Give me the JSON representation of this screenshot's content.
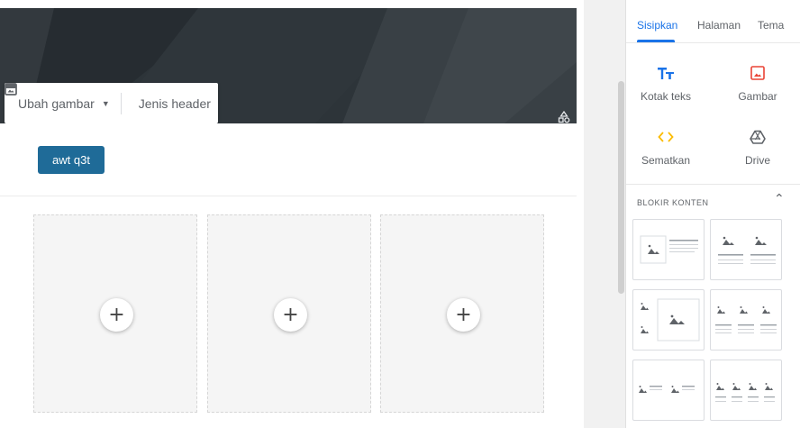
{
  "header": {
    "change_image_label": "Ubah gambar",
    "header_type_label": "Jenis header",
    "change_image_icon": "image-icon",
    "header_type_icon": "header-layout-icon",
    "theme_icon": "shapes-icon"
  },
  "main": {
    "button_label": "awt q3t",
    "button_color": "#1f6b98",
    "placeholders": [
      {
        "action": "+"
      },
      {
        "action": "+"
      },
      {
        "action": "+"
      }
    ]
  },
  "panel": {
    "tabs": [
      {
        "label": "Sisipkan",
        "active": true
      },
      {
        "label": "Halaman",
        "active": false
      },
      {
        "label": "Tema",
        "active": false
      }
    ],
    "insert_items": [
      {
        "label": "Kotak teks",
        "icon": "text-box-icon",
        "color": "#1a73e8"
      },
      {
        "label": "Gambar",
        "icon": "image-icon",
        "color": "#ea4335"
      },
      {
        "label": "Sematkan",
        "icon": "embed-icon",
        "color": "#fbbc04"
      },
      {
        "label": "Drive",
        "icon": "drive-icon",
        "color": "#5f6368"
      }
    ],
    "content_blocks_title": "BLOKIR KONTEN",
    "content_blocks_chevron": "^",
    "accent_color": "#1a73e8"
  }
}
